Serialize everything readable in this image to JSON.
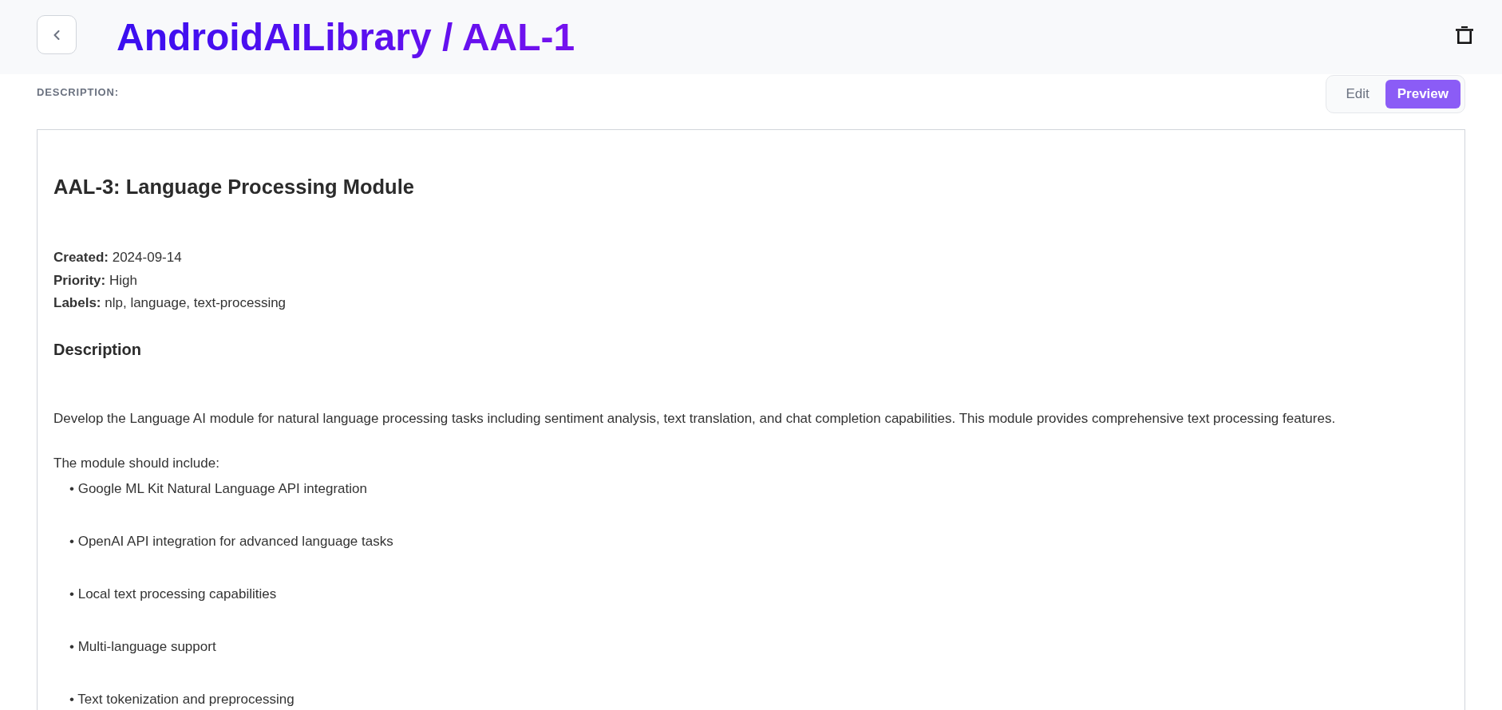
{
  "header": {
    "title": "AndroidAILibrary / AAL-1"
  },
  "section_label": "DESCRIPTION:",
  "mode_toggle": [
    {
      "label": "Edit",
      "selected": false
    },
    {
      "label": "Preview",
      "selected": true
    }
  ],
  "preview": {
    "heading": "AAL-3: Language Processing Module",
    "meta": [
      "**Created:** 2024-09-14",
      "**Priority:** High",
      "**Labels:** nlp, language, text-processing"
    ],
    "section_heading": "Description",
    "paragraph": "Develop the Language AI module for natural language processing tasks including sentiment analysis, text translation, and chat completion capabilities. This module provides comprehensive text processing features.",
    "list_intro": "The module should include:",
    "bullets": [
      "• Google ML Kit Natural Language API integration",
      "• OpenAI API integration for advanced language tasks",
      "• Local text processing capabilities",
      "• Multi-language support",
      "• Text tokenization and preprocessing"
    ]
  }
}
